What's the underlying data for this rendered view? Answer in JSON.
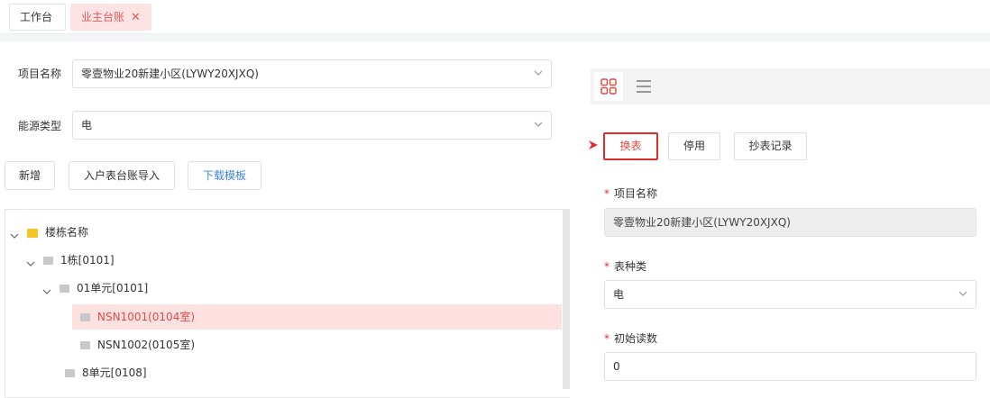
{
  "tabs": [
    {
      "label": "工作台"
    },
    {
      "label": "业主台账",
      "active": true
    }
  ],
  "form": {
    "project_label": "项目名称",
    "project_value": "零壹物业20新建小区(LYWY20XJXQ)",
    "energy_label": "能源类型",
    "energy_value": "电"
  },
  "actions": {
    "add": "新增",
    "import": "入户表台账导入",
    "download": "下载模板"
  },
  "tree": {
    "nodes": [
      {
        "label": "楼栋名称",
        "level": 0,
        "expanded": true,
        "type": "folder"
      },
      {
        "label": "1栋[0101]",
        "level": 1,
        "expanded": true
      },
      {
        "label": "01单元[0101]",
        "level": 2,
        "expanded": true
      },
      {
        "label": "NSN1001(0104室)",
        "level": 3,
        "selected": true
      },
      {
        "label": "NSN1002(0105室)",
        "level": 3
      },
      {
        "label": "8单元[0108]",
        "level": 2
      }
    ]
  },
  "right": {
    "buttons": {
      "change_meter": "换表",
      "disable": "停用",
      "reading_records": "抄表记录"
    },
    "fields": {
      "project_label": "项目名称",
      "project_value": "零壹物业20新建小区(LYWY20XJXQ)",
      "meter_type_label": "表种类",
      "meter_type_value": "电",
      "initial_reading_label": "初始读数",
      "initial_reading_value": "0"
    },
    "required_mark": "*"
  },
  "colors": {
    "accent_red": "#e12b2b",
    "selected_bg": "#fde0e0",
    "link_blue": "#3f86d6",
    "folder_yellow": "#f7c327"
  },
  "icons": {
    "grid_view": "grid-view-icon",
    "list_view": "list-view-icon",
    "pointer": "pointer-arrow-icon"
  }
}
